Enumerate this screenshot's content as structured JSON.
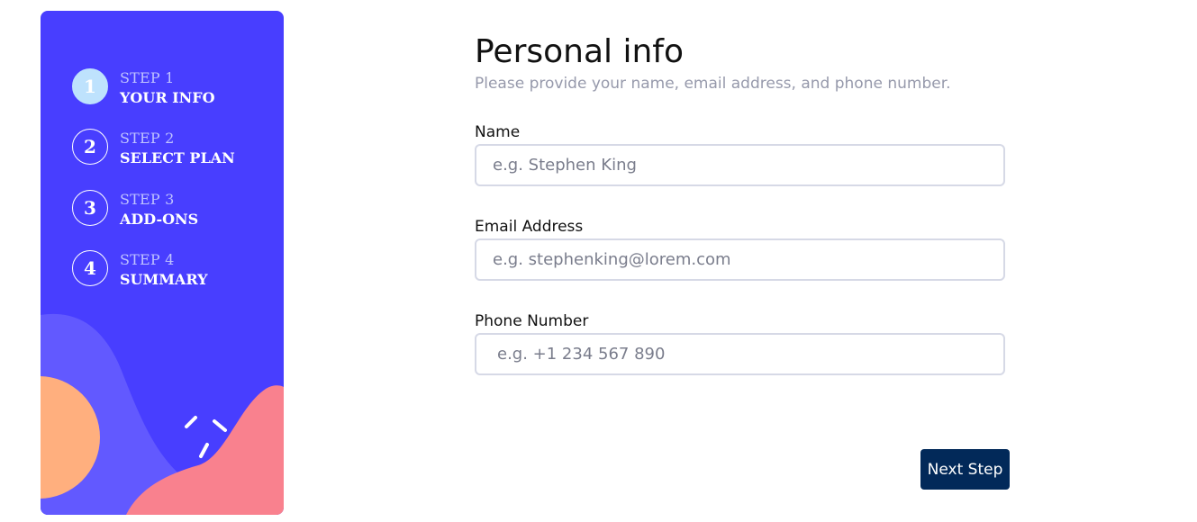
{
  "sidebar": {
    "steps": [
      {
        "number": "1",
        "title": "STEP 1",
        "label": "YOUR INFO",
        "active": true
      },
      {
        "number": "2",
        "title": "STEP 2",
        "label": "SELECT PLAN",
        "active": false
      },
      {
        "number": "3",
        "title": "STEP 3",
        "label": "ADD-ONS",
        "active": false
      },
      {
        "number": "4",
        "title": "STEP 4",
        "label": "SUMMARY",
        "active": false
      }
    ]
  },
  "form": {
    "heading": "Personal info",
    "subheading": "Please provide your name, email address, and phone number.",
    "fields": {
      "name": {
        "label": "Name",
        "placeholder": "e.g. Stephen King",
        "value": ""
      },
      "email": {
        "label": "Email Address",
        "placeholder": "e.g. stephenking@lorem.com",
        "value": ""
      },
      "phone": {
        "label": "Phone Number",
        "placeholder": "e.g. +1 234 567 890",
        "value": ""
      }
    },
    "next_label": "Next Step"
  },
  "colors": {
    "sidebar_bg": "#483eff",
    "active_step_bg": "#bee2fd",
    "button_bg": "#022959",
    "subheading": "#9699ab",
    "input_border": "#d6d9e6",
    "decor_purple": "#6259ff",
    "decor_orange": "#ffaf7e",
    "decor_pink": "#f9818e"
  }
}
